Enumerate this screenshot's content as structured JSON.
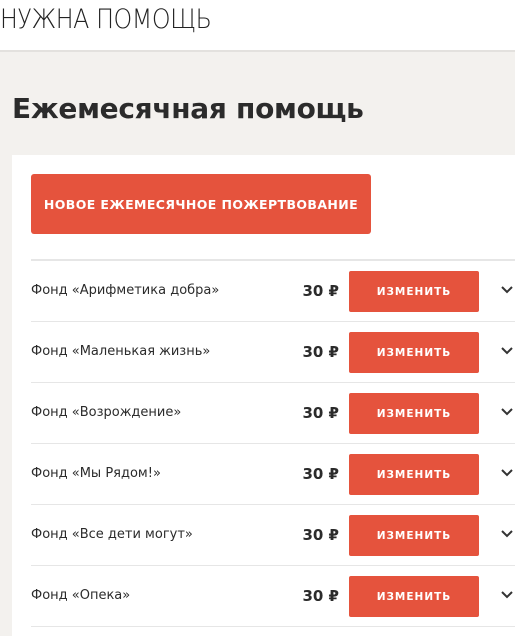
{
  "header": {
    "logo": "НУЖНА ПОМОЩЬ"
  },
  "page": {
    "title": "Ежемесячная помощь"
  },
  "actions": {
    "new_donation_label": "НОВОЕ ЕЖЕМЕСЯЧНОЕ ПОЖЕРТВОВАНИЕ"
  },
  "donations": [
    {
      "fund": "Фонд «Арифметика добра»",
      "amount": "30 ₽",
      "button": "ИЗМЕНИТЬ"
    },
    {
      "fund": "Фонд «Маленькая жизнь»",
      "amount": "30 ₽",
      "button": "ИЗМЕНИТЬ"
    },
    {
      "fund": "Фонд «Возрождение»",
      "amount": "30 ₽",
      "button": "ИЗМЕНИТЬ"
    },
    {
      "fund": "Фонд «Мы Рядом!»",
      "amount": "30 ₽",
      "button": "ИЗМЕНИТЬ"
    },
    {
      "fund": "Фонд «Все дети могут»",
      "amount": "30 ₽",
      "button": "ИЗМЕНИТЬ"
    },
    {
      "fund": "Фонд «Опека»",
      "amount": "30 ₽",
      "button": "ИЗМЕНИТЬ"
    }
  ],
  "colors": {
    "accent": "#e5533d",
    "page_bg": "#f3f1ee",
    "card_bg": "#ffffff"
  },
  "icons": {
    "row_toggle": "chevron-down-icon"
  }
}
